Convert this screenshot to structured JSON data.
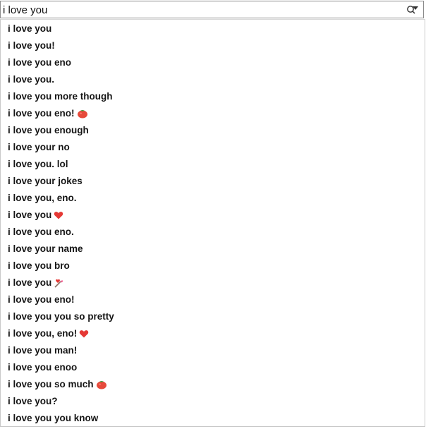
{
  "search": {
    "value": "i love you",
    "filter_icon": "filter-search-icon"
  },
  "suggestions": [
    {
      "text": "i love you",
      "emoji": null
    },
    {
      "text": "i love you!",
      "emoji": null
    },
    {
      "text": "i love you eno",
      "emoji": null
    },
    {
      "text": "i love you.",
      "emoji": null
    },
    {
      "text": "i love you more though",
      "emoji": null
    },
    {
      "text": "i love you eno! ",
      "emoji": "tomato-icon"
    },
    {
      "text": "i love you enough",
      "emoji": null
    },
    {
      "text": "i love your no",
      "emoji": null
    },
    {
      "text": "i love you. lol",
      "emoji": null
    },
    {
      "text": "i love your jokes",
      "emoji": null
    },
    {
      "text": "i love you, eno.",
      "emoji": null
    },
    {
      "text": "i love you",
      "emoji": "red-heart-icon"
    },
    {
      "text": "i love you eno.",
      "emoji": null
    },
    {
      "text": "i love your name",
      "emoji": null
    },
    {
      "text": "i love you bro",
      "emoji": null
    },
    {
      "text": "i love you",
      "emoji": "love-letter-icon"
    },
    {
      "text": "i love you eno!",
      "emoji": null
    },
    {
      "text": "i love you you so pretty",
      "emoji": null
    },
    {
      "text": "i love you, eno!",
      "emoji": "red-heart-icon"
    },
    {
      "text": "i love you man!",
      "emoji": null
    },
    {
      "text": "i love you enoo",
      "emoji": null
    },
    {
      "text": "i love you so much",
      "emoji": "tomato-icon"
    },
    {
      "text": "i love you?",
      "emoji": null
    },
    {
      "text": "i love you you know",
      "emoji": null
    }
  ],
  "colors": {
    "heart": "#e53935",
    "tomato": "#e64a3b",
    "text": "#151515",
    "border": "#8b8b8b"
  }
}
